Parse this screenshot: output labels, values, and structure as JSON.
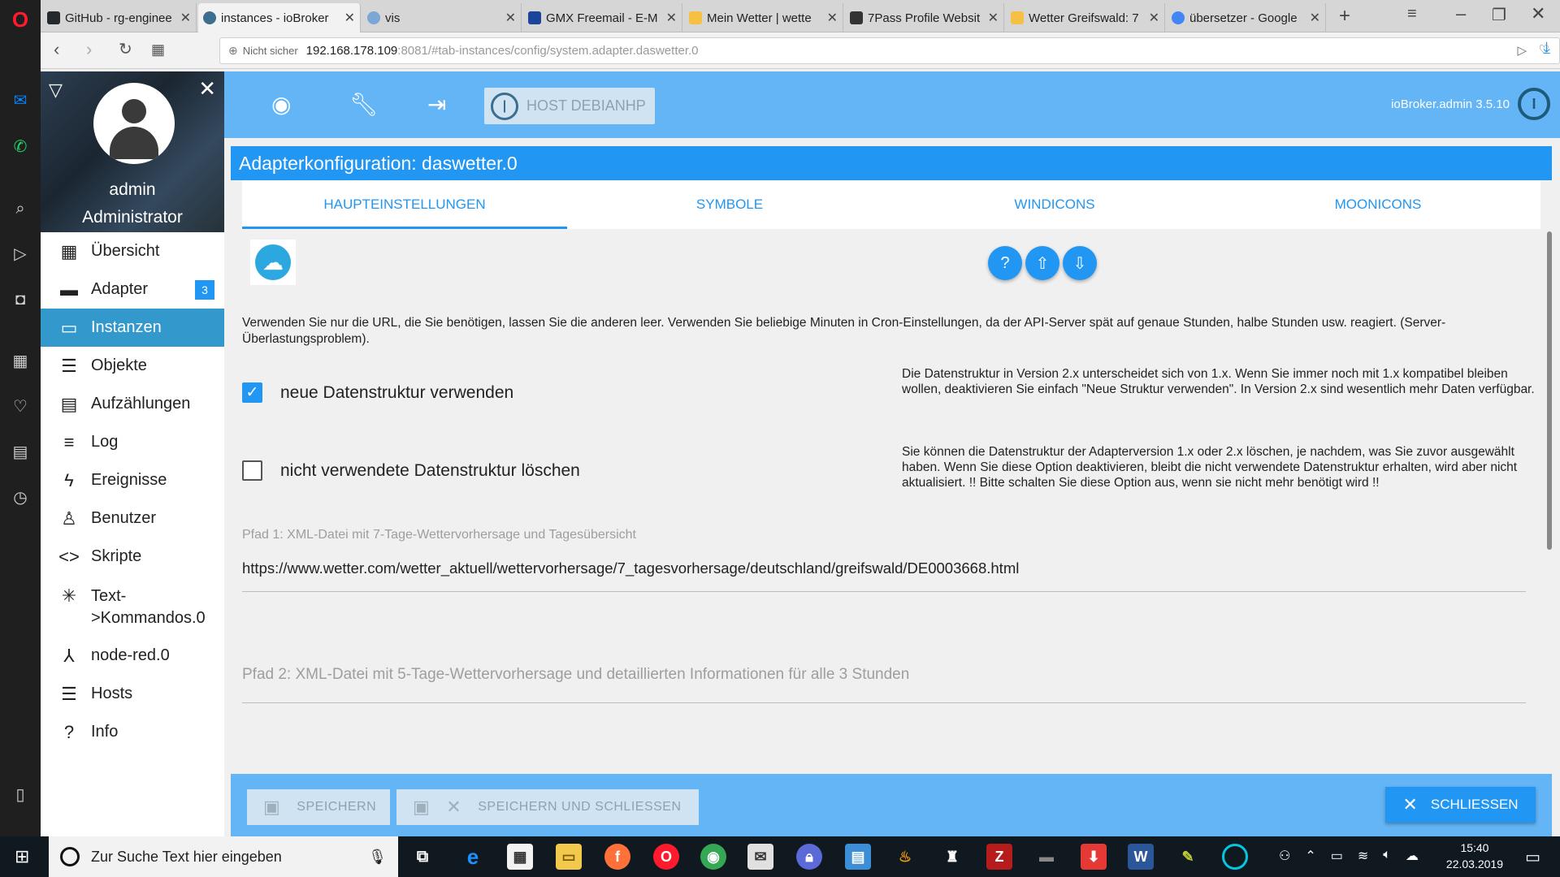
{
  "browser": {
    "tabs": [
      {
        "label": "GitHub - rg-enginee",
        "fav": "#24292e"
      },
      {
        "label": "instances - ioBroker",
        "fav": "#3c6e8f"
      },
      {
        "label": "vis",
        "fav": "#7aa7d6"
      },
      {
        "label": "GMX Freemail - E-M",
        "fav": "#1c449b"
      },
      {
        "label": "Mein Wetter | wette",
        "fav": "#f6c142"
      },
      {
        "label": "7Pass Profile Websit",
        "fav": "#333333"
      },
      {
        "label": "Wetter Greifswald: 7",
        "fav": "#f6c142"
      },
      {
        "label": "übersetzer - Google",
        "fav": "#4285f4"
      }
    ],
    "not_secure": "Nicht sicher",
    "url_host": "192.168.178.109",
    "url_rest": ":8081/#tab-instances/config/system.adapter.daswetter.0"
  },
  "sidebar": {
    "username": "admin",
    "role": "Administrator",
    "items": [
      {
        "label": "Übersicht",
        "icon": "grid-icon"
      },
      {
        "label": "Adapter",
        "icon": "store-icon",
        "badge": "3"
      },
      {
        "label": "Instanzen",
        "icon": "instances-icon"
      },
      {
        "label": "Objekte",
        "icon": "list-icon"
      },
      {
        "label": "Aufzählungen",
        "icon": "enum-icon"
      },
      {
        "label": "Log",
        "icon": "log-icon"
      },
      {
        "label": "Ereignisse",
        "icon": "flash-icon"
      },
      {
        "label": "Benutzer",
        "icon": "user-icon"
      },
      {
        "label": "Skripte",
        "icon": "code-icon"
      },
      {
        "label": "Text-",
        "label2": ">Kommandos.0",
        "icon": "asterisk-icon"
      },
      {
        "label": "node-red.0",
        "icon": "nodes-icon"
      },
      {
        "label": "Hosts",
        "icon": "hosts-icon"
      },
      {
        "label": "Info",
        "icon": "help-icon"
      }
    ]
  },
  "topbar": {
    "host_label": "HOST DEBIANHP",
    "version": "ioBroker.admin 3.5.10"
  },
  "config": {
    "title": "Adapterkonfiguration: daswetter.0",
    "tabs": [
      "HAUPTEINSTELLUNGEN",
      "SYMBOLE",
      "WINDICONS",
      "MOONICONS"
    ],
    "info_text": "Verwenden Sie nur die URL, die Sie benötigen, lassen Sie die anderen leer. Verwenden Sie beliebige Minuten in Cron-Einstellungen, da der API-Server spät auf genaue Stunden, halbe Stunden usw. reagiert. (Server-Überlastungsproblem).",
    "checkbox1": {
      "label": "neue Datenstruktur verwenden",
      "checked": true
    },
    "help1": "Die Datenstruktur in Version 2.x unterscheidet sich von 1.x. Wenn Sie immer noch mit 1.x kompatibel bleiben wollen, deaktivieren Sie einfach \"Neue Struktur verwenden\". In Version 2.x sind wesentlich mehr Daten verfügbar.",
    "checkbox2": {
      "label": "nicht verwendete Datenstruktur löschen",
      "checked": false
    },
    "help2": "Sie können die Datenstruktur der Adapterversion 1.x oder 2.x löschen, je nachdem, was Sie zuvor ausgewählt haben. Wenn Sie diese Option deaktivieren, bleibt die nicht verwendete Datenstruktur erhalten, wird aber nicht aktualisiert. !! Bitte schalten Sie diese Option aus, wenn sie nicht mehr benötigt wird !!",
    "path1_label": "Pfad 1: XML-Datei mit 7-Tage-Wettervorhersage und Tagesübersicht",
    "path1_value": "https://www.wetter.com/wetter_aktuell/wettervorhersage/7_tagesvorhersage/deutschland/greifswald/DE0003668.html",
    "path2_label": "Pfad 2: XML-Datei mit 5-Tage-Wettervorhersage und detaillierten Informationen für alle 3 Stunden",
    "path2_value": ""
  },
  "bottom": {
    "save": "SPEICHERN",
    "save_close": "SPEICHERN UND SCHLIESSEN",
    "close": "SCHLIESSEN"
  },
  "taskbar": {
    "search_placeholder": "Zur Suche Text hier eingeben",
    "time": "15:40",
    "date": "22.03.2019"
  }
}
